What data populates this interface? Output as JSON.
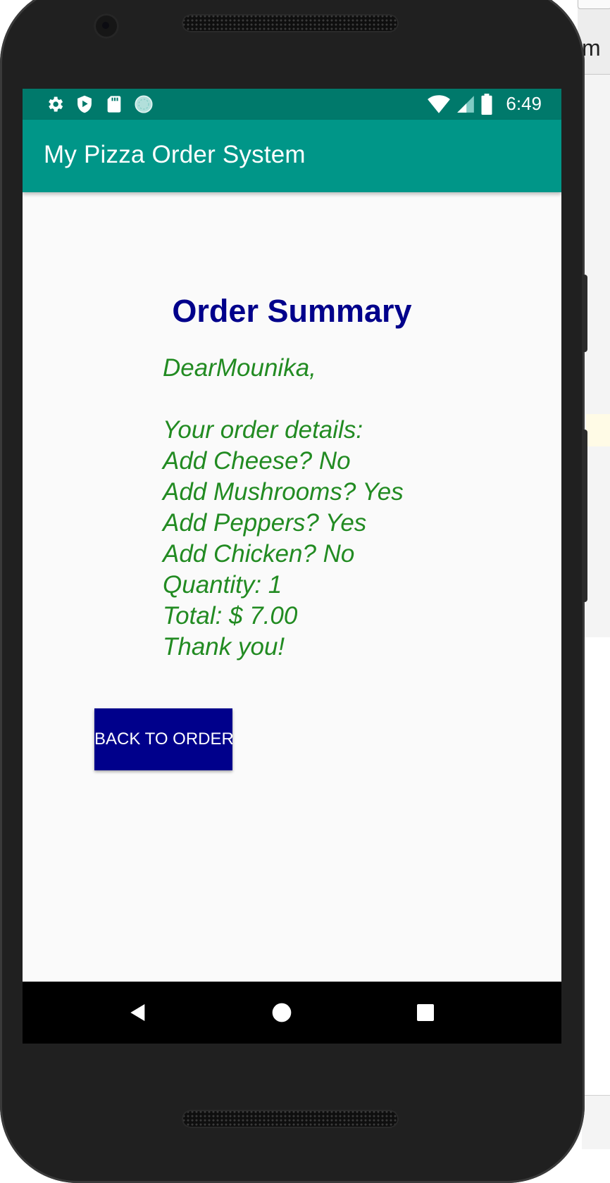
{
  "desktop": {
    "side_window_text": "m"
  },
  "status_bar": {
    "time": "6:49",
    "left_icons": [
      "settings-icon",
      "shield-play-icon",
      "sd-card-icon",
      "loading-circle-icon"
    ],
    "right_icons": [
      "wifi-icon",
      "signal-icon",
      "battery-icon"
    ]
  },
  "app_bar": {
    "title": "My Pizza Order System"
  },
  "summary": {
    "heading": "Order Summary",
    "lines": [
      "DearMounika,",
      "",
      "Your order details:",
      "Add Cheese? No",
      "Add Mushrooms? Yes",
      "Add Peppers? Yes",
      "Add Chicken? No",
      "Quantity: 1",
      "Total: $ 7.00",
      "Thank you!"
    ]
  },
  "buttons": {
    "back_to_order": "BACK TO ORDER"
  },
  "nav_bar": {
    "items": [
      "back-icon",
      "home-icon",
      "recents-icon"
    ]
  },
  "colors": {
    "status_bar": "#00796b",
    "app_bar": "#009688",
    "heading": "#00008b",
    "summary_text": "#228b22",
    "button": "#00008b"
  }
}
